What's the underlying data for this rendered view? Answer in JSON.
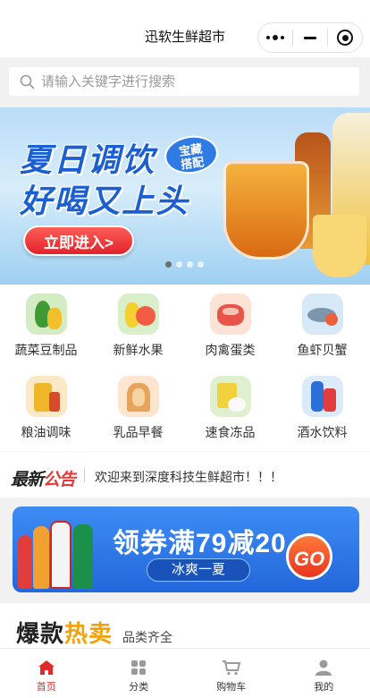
{
  "header": {
    "title": "迅软生鲜超市"
  },
  "search": {
    "placeholder": "请输入关键字进行搜索"
  },
  "banner": {
    "line1": "夏日调饮",
    "line2": "好喝又上头",
    "badge_line1": "宝藏",
    "badge_line2": "搭配",
    "button": "立即进入>",
    "slide_count": 4,
    "active_slide": 1
  },
  "categories": [
    {
      "label": "蔬菜豆制品",
      "icon": "vegetables-icon"
    },
    {
      "label": "新鲜水果",
      "icon": "fruit-icon"
    },
    {
      "label": "肉禽蛋类",
      "icon": "meat-icon"
    },
    {
      "label": "鱼虾贝蟹",
      "icon": "seafood-icon"
    },
    {
      "label": "粮油调味",
      "icon": "oil-icon"
    },
    {
      "label": "乳品早餐",
      "icon": "bread-icon"
    },
    {
      "label": "速食冻品",
      "icon": "frozen-food-icon"
    },
    {
      "label": "酒水饮料",
      "icon": "drinks-icon"
    }
  ],
  "notice": {
    "tag_a": "最新",
    "tag_b": "公告",
    "message": "欢迎来到深度科技生鲜超市！！！"
  },
  "promo": {
    "title": "领券满79减20",
    "subtitle": "冰爽一夏",
    "go": "GO"
  },
  "hot": {
    "title_a": "爆款",
    "title_b": "热卖",
    "subtitle": "品类齐全"
  },
  "tabbar": [
    {
      "label": "首页",
      "active": true
    },
    {
      "label": "分类",
      "active": false
    },
    {
      "label": "购物车",
      "active": false
    },
    {
      "label": "我的",
      "active": false
    }
  ],
  "colors": {
    "accent": "#e02a2a",
    "banner_blue": "#1c5fd1",
    "promo_blue": "#2f7be6"
  }
}
